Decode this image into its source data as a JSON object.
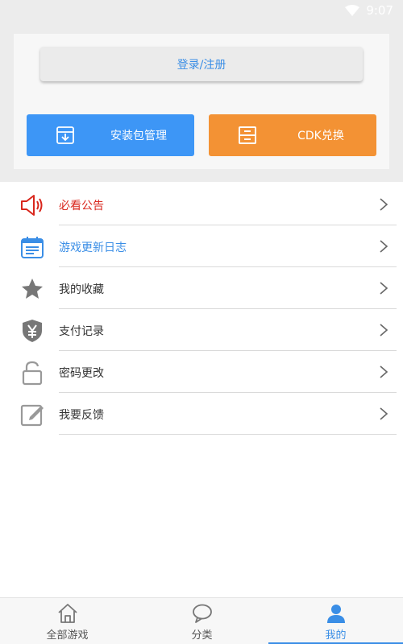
{
  "status_bar": {
    "time": "9:07"
  },
  "top_card": {
    "login_label": "登录/注册",
    "install_label": "安装包管理",
    "cdk_label": "CDK兑换"
  },
  "menu": {
    "items": [
      {
        "label": "必看公告",
        "color": "#d9261c",
        "icon": "megaphone-icon"
      },
      {
        "label": "游戏更新日志",
        "color": "#3a8ee6",
        "icon": "calendar-log-icon"
      },
      {
        "label": "我的收藏",
        "color": "#333333",
        "icon": "star-icon"
      },
      {
        "label": "支付记录",
        "color": "#333333",
        "icon": "yuan-shield-icon"
      },
      {
        "label": "密码更改",
        "color": "#333333",
        "icon": "unlock-icon"
      },
      {
        "label": "我要反馈",
        "color": "#333333",
        "icon": "edit-icon"
      }
    ]
  },
  "bottom_nav": {
    "items": [
      {
        "label": "全部游戏",
        "icon": "home-icon"
      },
      {
        "label": "分类",
        "icon": "chat-bubble-icon"
      },
      {
        "label": "我的",
        "icon": "person-icon",
        "active": true
      }
    ]
  },
  "colors": {
    "accent": "#3a8ee6",
    "install_button": "#3d96f6",
    "cdk_button": "#f39234",
    "announcement_red": "#d9261c"
  }
}
